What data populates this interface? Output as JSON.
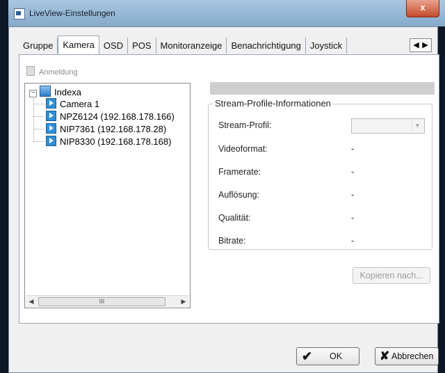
{
  "window": {
    "title": "LiveView-Einstellungen",
    "close_glyph": "x"
  },
  "tabs": [
    {
      "label": "Gruppe"
    },
    {
      "label": "Kamera"
    },
    {
      "label": "OSD"
    },
    {
      "label": "POS"
    },
    {
      "label": "Monitoranzeige"
    },
    {
      "label": "Benachrichtigung"
    },
    {
      "label": "Joystick"
    }
  ],
  "tab_scroll": {
    "left": "◀",
    "right": "▶"
  },
  "toolbar": {
    "login_label": "Anmeldung"
  },
  "tree": {
    "root": {
      "label": "Indexa",
      "expander": "−"
    },
    "items": [
      {
        "label": "Camera 1"
      },
      {
        "label": "NPZ6124 (192.168.178.166)"
      },
      {
        "label": "NIP7361 (192.168.178.28)"
      },
      {
        "label": "NIP8330 (192.168.178.168)"
      }
    ],
    "scroll": {
      "left": "◀",
      "right": "▶",
      "thumb": "III"
    }
  },
  "stream": {
    "group_title": "Stream-Profile-Informationen",
    "rows": [
      {
        "label": "Stream-Profil:",
        "value": ""
      },
      {
        "label": "Videoformat:",
        "value": "-"
      },
      {
        "label": "Framerate:",
        "value": "-"
      },
      {
        "label": "Auflösung:",
        "value": "-"
      },
      {
        "label": "Qualität:",
        "value": "-"
      },
      {
        "label": "Bitrate:",
        "value": "-"
      }
    ],
    "combo_arrow": "▼"
  },
  "buttons": {
    "copy": "Kopieren nach...",
    "ok": "OK",
    "cancel": "Abbrechen"
  },
  "icons": {
    "check": "✔",
    "x": "✘"
  }
}
